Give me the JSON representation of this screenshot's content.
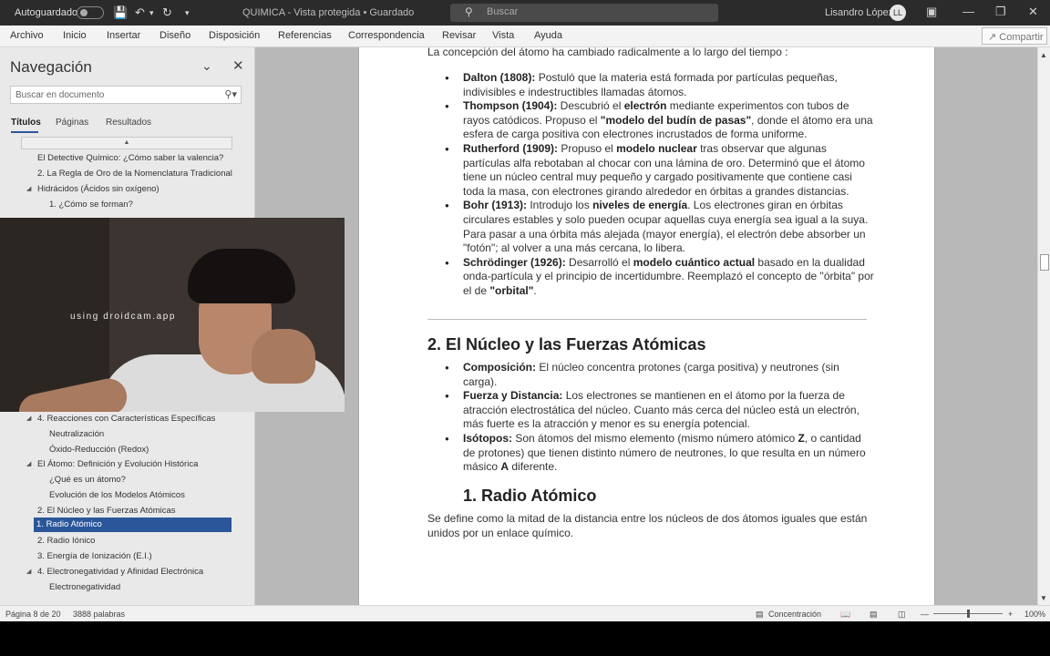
{
  "titlebar": {
    "autosave": "Autoguardado",
    "doc_title": "QUIMICA  -  Vista protegida  •  Guardado",
    "search_placeholder": "Buscar",
    "user_name": "Lisandro López",
    "user_initials": "LL"
  },
  "ribbon": {
    "tabs": [
      "Archivo",
      "Inicio",
      "Insertar",
      "Diseño",
      "Disposición",
      "Referencias",
      "Correspondencia",
      "Revisar",
      "Vista",
      "Ayuda"
    ],
    "share": "Compartir"
  },
  "navigation": {
    "title": "Navegación",
    "search_placeholder": "Buscar en documento",
    "tabs": [
      "Títulos",
      "Páginas",
      "Resultados"
    ],
    "items": [
      "El Detective Químico: ¿Cómo saber la valencia?",
      "2. La Regla de Oro de la Nomenclatura Tradicional",
      "Hidrácidos (Ácidos sin oxígeno)",
      "1. ¿Cómo se forman?",
      "4. Reacciones con Características Específicas",
      "Neutralización",
      "Óxido-Reducción (Redox)",
      "El Átomo: Definición y Evolución Histórica",
      "¿Qué es un átomo?",
      "Evolución de los Modelos Atómicos",
      "2. El Núcleo y las Fuerzas Atómicas",
      "1. Radio Atómico",
      "2. Radio Iónico",
      "3. Energía de Ionización (E.I.)",
      "4. Electronegatividad y Afinidad Electrónica",
      "Electronegatividad"
    ],
    "selected_index": 11
  },
  "webcam": {
    "watermark": "using droidcam.app"
  },
  "document": {
    "intro": "La concepción del átomo ha cambiado radicalmente a lo largo del tiempo :",
    "models": [
      {
        "lead": "Dalton (1808):",
        "text": " Postuló que la materia está formada por partículas pequeñas, indivisibles e indestructibles llamadas átomos."
      },
      {
        "lead": "Thompson (1904):",
        "text1": " Descubrió el ",
        "b1": "electrón",
        "text2": " mediante experimentos con tubos de rayos catódicos. Propuso el ",
        "b2": "\"modelo del budín de pasas\"",
        "text3": ", donde el átomo era una esfera de carga positiva con electrones incrustados de forma uniforme."
      },
      {
        "lead": "Rutherford (1909):",
        "text1": " Propuso el ",
        "b1": "modelo nuclear",
        "text2": " tras observar que algunas partículas alfa rebotaban al chocar con una lámina de oro. Determinó que el átomo tiene un núcleo central muy pequeño y cargado positivamente que contiene casi toda la masa, con electrones girando alrededor en órbitas a grandes distancias."
      },
      {
        "lead": "Bohr (1913):",
        "text1": " Introdujo los ",
        "b1": "niveles de energía",
        "text2": ". Los electrones giran en órbitas circulares estables y solo pueden ocupar aquellas cuya energía sea igual a la suya. Para pasar a una órbita más alejada (mayor energía), el electrón debe absorber un \"fotón\"; al volver a una más cercana, lo libera."
      },
      {
        "lead": "Schrödinger (1926):",
        "text1": " Desarrolló el ",
        "b1": "modelo cuántico actual",
        "text2": " basado en la dualidad onda-partícula y el principio de incertidumbre. Reemplazó el concepto de \"órbita\" por el de ",
        "b2": "\"orbital\"",
        "text3": "."
      }
    ],
    "section2_title": "2. El Núcleo y las Fuerzas Atómicas",
    "section2_items": [
      {
        "lead": "Composición:",
        "text": " El núcleo concentra protones (carga positiva) y neutrones (sin carga)."
      },
      {
        "lead": "Fuerza y Distancia:",
        "text": " Los electrones se mantienen en el átomo por la fuerza de atracción electrostática del núcleo. Cuanto más cerca del núcleo está un electrón, más fuerte es la atracción y menor es su energía potencial."
      },
      {
        "lead": "Isótopos:",
        "text1": " Son átomos del mismo elemento (mismo número atómico ",
        "b1": "Z",
        "text2": ", o cantidad de protones) que tienen distinto número de neutrones, lo que resulta en un número másico ",
        "b2": "A",
        "text3": " diferente."
      }
    ],
    "section3_title": "1. Radio Atómico",
    "section3_text": "Se define como la mitad de la distancia entre los núcleos de dos átomos iguales que están unidos por un enlace químico."
  },
  "statusbar": {
    "page": "Página 8 de 20",
    "words": "3888 palabras",
    "focus": "Concentración",
    "zoom": "100%"
  }
}
